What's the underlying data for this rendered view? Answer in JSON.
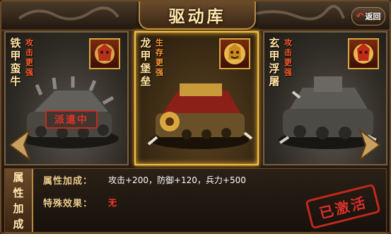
{
  "header": {
    "title": "驱动库",
    "back_label": "返回"
  },
  "cards": [
    {
      "name": "铁甲蛮牛",
      "tag": "攻击更强",
      "status": "派遣中"
    },
    {
      "name": "龙甲堡垒",
      "tag": "生存更强"
    },
    {
      "name": "玄甲浮屠",
      "tag": "攻击更强"
    }
  ],
  "attributes": {
    "tab_label": "属性加成",
    "attr_label": "属性加成：",
    "attr_value": "攻击+200，防御+120，兵力+500",
    "special_label": "特殊效果：",
    "special_value": "无",
    "active_stamp": "已激活"
  },
  "colors": {
    "accent": "#f1c14a",
    "stamp_red": "#d8302a"
  }
}
